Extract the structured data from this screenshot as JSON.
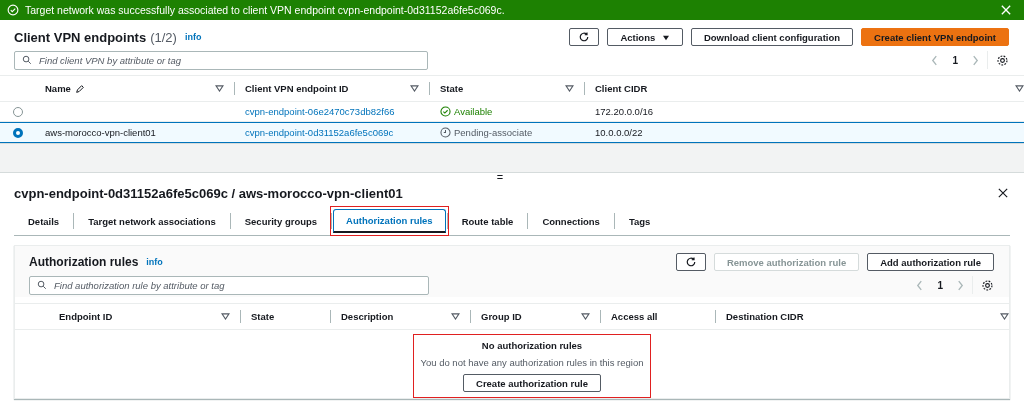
{
  "banner": {
    "kind": "success",
    "message": "Target network was successfully associated to client VPN endpoint cvpn-endpoint-0d31152a6fe5c069c."
  },
  "endpoints": {
    "title": "Client VPN endpoints",
    "count": "(1/2)",
    "info": "info",
    "actions": "Actions",
    "download": "Download client configuration",
    "create": "Create client VPN endpoint",
    "search": {
      "placeholder": "Find client VPN by attribute or tag"
    },
    "page": "1",
    "columns": [
      {
        "label": "Name",
        "editable": true,
        "sortable": true
      },
      {
        "label": "Client VPN endpoint ID",
        "editable": false,
        "sortable": true
      },
      {
        "label": "State",
        "editable": false,
        "sortable": true
      },
      {
        "label": "Client CIDR",
        "editable": false,
        "sortable": true
      }
    ],
    "rows": [
      {
        "selected": false,
        "name": "",
        "id": "cvpn-endpoint-06e2470c73db82f66",
        "state": {
          "kind": "available",
          "label": "Available"
        },
        "cidr": "172.20.0.0/16"
      },
      {
        "selected": true,
        "name": "aws-morocco-vpn-client01",
        "id": "cvpn-endpoint-0d31152a6fe5c069c",
        "state": {
          "kind": "pending",
          "label": "Pending-associate"
        },
        "cidr": "10.0.0.0/22"
      }
    ]
  },
  "splitter": "=",
  "details": {
    "title": "cvpn-endpoint-0d31152a6fe5c069c / aws-morocco-vpn-client01",
    "tabs": [
      {
        "label": "Details",
        "selected": false,
        "highlighted": false
      },
      {
        "label": "Target network associations",
        "selected": false,
        "highlighted": false
      },
      {
        "label": "Security groups",
        "selected": false,
        "highlighted": false
      },
      {
        "label": "Authorization rules",
        "selected": true,
        "highlighted": true
      },
      {
        "label": "Route table",
        "selected": false,
        "highlighted": false
      },
      {
        "label": "Connections",
        "selected": false,
        "highlighted": false
      },
      {
        "label": "Tags",
        "selected": false,
        "highlighted": false
      }
    ],
    "rules": {
      "title": "Authorization rules",
      "info": "info",
      "remove": {
        "label": "Remove authorization rule",
        "disabled": true
      },
      "add": {
        "label": "Add authorization rule",
        "disabled": false
      },
      "search": {
        "placeholder": "Find authorization rule by attribute or tag"
      },
      "page": "1",
      "columns": [
        {
          "label": "Endpoint ID",
          "sortable": true
        },
        {
          "label": "State",
          "sortable": false
        },
        {
          "label": "Description",
          "sortable": true
        },
        {
          "label": "Group ID",
          "sortable": true
        },
        {
          "label": "Access all",
          "sortable": false
        },
        {
          "label": "Destination CIDR",
          "sortable": true
        }
      ],
      "empty": {
        "title": "No authorization rules",
        "message": "You do not have any authorization rules in this region",
        "button": "Create authorization rule",
        "highlighted": true
      }
    }
  }
}
